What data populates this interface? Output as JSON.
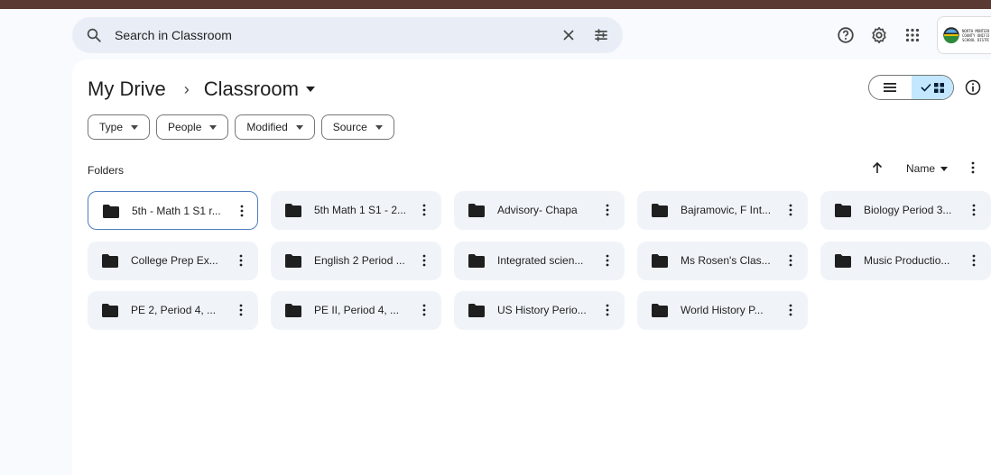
{
  "search": {
    "placeholder": "Search in Classroom",
    "icon": "search-icon",
    "clear_icon": "close-icon",
    "filter_icon": "tune-icon"
  },
  "header_icons": [
    "help-icon",
    "settings-icon",
    "apps-icon"
  ],
  "logo": {
    "text": "NORTH MONTEREY\nCOUNTY UNIFIED\nSCHOOL DISTRICT"
  },
  "breadcrumb": {
    "root": "My Drive",
    "separator": "›",
    "current": "Classroom"
  },
  "view_toggle": {
    "list_icon": "list-icon",
    "grid_icon": "grid-icon",
    "active": "grid"
  },
  "filters": [
    {
      "label": "Type"
    },
    {
      "label": "People"
    },
    {
      "label": "Modified"
    },
    {
      "label": "Source"
    }
  ],
  "section": {
    "label": "Folders",
    "sort_label": "Name"
  },
  "folders": [
    {
      "name": "5th - Math 1 S1 r...",
      "selected": true
    },
    {
      "name": "5th Math 1 S1 - 2...",
      "selected": false
    },
    {
      "name": "Advisory- Chapa",
      "selected": false
    },
    {
      "name": "Bajramovic, F Int...",
      "selected": false
    },
    {
      "name": "Biology Period 3...",
      "selected": false
    },
    {
      "name": "College Prep Ex...",
      "selected": false
    },
    {
      "name": "English 2 Period ...",
      "selected": false
    },
    {
      "name": "Integrated scien...",
      "selected": false
    },
    {
      "name": "Ms Rosen's Clas...",
      "selected": false
    },
    {
      "name": "Music Productio...",
      "selected": false
    },
    {
      "name": "PE 2, Period 4, ...",
      "selected": false
    },
    {
      "name": "PE II, Period 4, ...",
      "selected": false
    },
    {
      "name": "US History Perio...",
      "selected": false
    },
    {
      "name": "World History P...",
      "selected": false
    }
  ],
  "colors": {
    "top_strip": "#5b3a33",
    "search_bg": "#e9eef6",
    "folder_bg": "#f0f4f9",
    "selected_border": "#4f7ec0",
    "active_toggle": "#c2e7ff"
  }
}
